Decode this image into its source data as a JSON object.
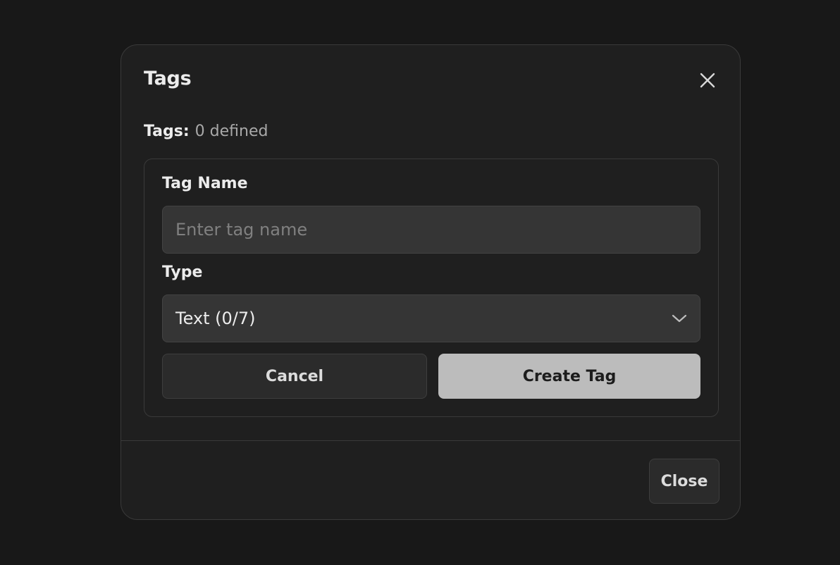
{
  "dialog": {
    "title": "Tags",
    "close_icon": "close-icon",
    "summary": {
      "label": "Tags:",
      "count_text": "0 defined"
    },
    "form": {
      "tag_name_label": "Tag Name",
      "tag_name_placeholder": "Enter tag name",
      "tag_name_value": "",
      "type_label": "Type",
      "type_value": "Text (0/7)",
      "type_icon": "chevron-down-icon",
      "cancel_label": "Cancel",
      "create_label": "Create Tag"
    },
    "footer": {
      "close_label": "Close"
    }
  },
  "colors": {
    "background": "#181818",
    "dialog_bg": "#1f1f1f",
    "input_bg": "#353535",
    "primary_button": "#bcbcbc",
    "secondary_button": "#2b2b2b",
    "border": "#3a3a3a"
  }
}
